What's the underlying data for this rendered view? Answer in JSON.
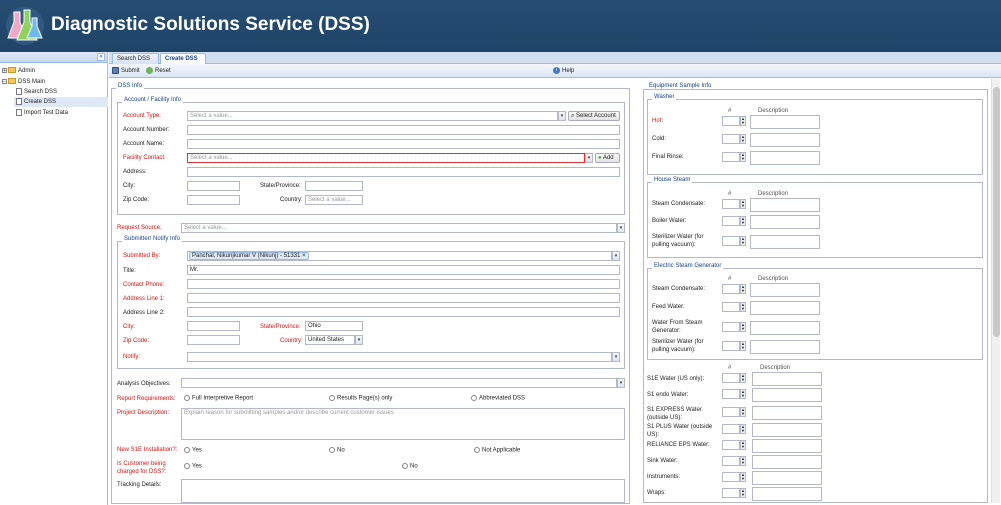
{
  "app": {
    "title": "Diagnostic Solutions Service (DSS)"
  },
  "sidebar": {
    "collapse_glyph": "«",
    "items": [
      {
        "label": "Admin"
      },
      {
        "label": "DSS Main"
      },
      {
        "label": "Search DSS"
      },
      {
        "label": "Create DSS"
      },
      {
        "label": "Import Test Data"
      }
    ]
  },
  "tabs": [
    {
      "label": "Search DSS"
    },
    {
      "label": "Create DSS"
    }
  ],
  "toolbar": {
    "submit_label": "Submit",
    "reset_label": "Reset",
    "help_label": "Help"
  },
  "dss_info": {
    "legend": "DSS Info",
    "account": {
      "legend": "Account / Facility Info",
      "account_type_label": "Account Type:",
      "account_type_placeholder": "Select a value...",
      "select_account_label": "Select Account",
      "account_number_label": "Account Number:",
      "account_name_label": "Account Name:",
      "facility_contact_label": "Facility Contact:",
      "facility_contact_placeholder": "Select a value...",
      "add_label": "Add",
      "address_label": "Address:",
      "city_label": "City:",
      "state_label": "State/Province:",
      "zip_label": "Zip Code:",
      "country_label": "Country:",
      "country_placeholder": "Select a value..."
    },
    "request_source_label": "Request Source:",
    "request_source_placeholder": "Select a value...",
    "submitter": {
      "legend": "Submitter/ Notify Info",
      "submitted_by_label": "Submitted By:",
      "submitted_by_value": "Panchal, Nikunjkumar V (Nikunj) - 51331",
      "title_label": "Title:",
      "title_value": "Mr.",
      "contact_phone_label": "Contact Phone:",
      "address1_label": "Address Line 1:",
      "address2_label": "Address Line 2:",
      "city_label": "City:",
      "state_label": "State/Province:",
      "state_value": "Ohio",
      "zip_label": "Zip Code:",
      "country_label": "Country:",
      "country_value": "United States",
      "notify_label": "Notify:"
    },
    "analysis_objectives_label": "Analysis Objectives:",
    "report_req_label": "Report Requirements:",
    "report_options": [
      "Full Interpretive Report",
      "Results Page(s) only",
      "Abbreviated DSS"
    ],
    "project_description_label": "Project Description:",
    "project_description_placeholder": "Explain reason for submitting samples and/or describe current customer issues",
    "new_s1e_label": "New S1E Installation?:",
    "new_s1e_options": [
      "Yes",
      "No",
      "Not Applicable"
    ],
    "charged_label_1": "Is Customer being",
    "charged_label_2": "charged for DSS?:",
    "charged_options": [
      "Yes",
      "No"
    ],
    "tracking_label": "Tracking Details:"
  },
  "equipment": {
    "legend": "Equipment Sample Info",
    "col_num": "#",
    "col_desc": "Description",
    "washer": {
      "legend": "Washer",
      "rows": [
        "Hot:",
        "Cold:",
        "Final Rinse:"
      ]
    },
    "house_steam": {
      "legend": "House Steam",
      "rows": [
        "Steam Condensate:",
        "Boiler Water:",
        "Sterilizer Water (for",
        "pulling vacuum):"
      ]
    },
    "electric": {
      "legend": "Electric Steam Generator",
      "rows": [
        "Steam Condensate:",
        "Feed Water:",
        "Water From Steam",
        "Generator:",
        "Sterilizer Water (for",
        "pulling vacuum):"
      ]
    },
    "other_rows": [
      "S1E Water (US only):",
      "S1 endo Water:",
      "S1 EXPRESS Water",
      "(outside US):",
      "S1 PLUS Water (outside",
      "US):",
      "RELIANCE EPS Water:",
      "Sink Water:",
      "Instruments:",
      "Wraps:"
    ]
  }
}
